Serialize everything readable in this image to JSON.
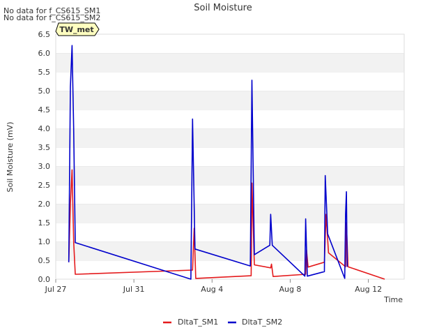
{
  "notes": [
    "No data for f_CS615_SM1",
    "No data for f_CS615_SM2"
  ],
  "badge": "TW_met",
  "chart_data": {
    "type": "line",
    "title": "Soil Moisture",
    "xlabel": "Time",
    "ylabel": "Soil Moisture (mV)",
    "ylim": [
      0.0,
      6.5
    ],
    "yticks": [
      "0.0",
      "0.5",
      "1.0",
      "1.5",
      "2.0",
      "2.5",
      "3.0",
      "3.5",
      "4.0",
      "4.5",
      "5.0",
      "5.5",
      "6.0",
      "6.5"
    ],
    "xlim": [
      "2024-07-27",
      "2024-08-13 20:00"
    ],
    "xticks": [
      {
        "label": "Jul 27",
        "date": "2024-07-27"
      },
      {
        "label": "Jul 31",
        "date": "2024-07-31"
      },
      {
        "label": "Aug 4",
        "date": "2024-08-04"
      },
      {
        "label": "Aug 8",
        "date": "2024-08-08"
      },
      {
        "label": "Aug 12",
        "date": "2024-08-12"
      }
    ],
    "grid": "horizontal bands",
    "legend": "bottom-center",
    "series": [
      {
        "name": "DltaT_SM1",
        "color": "#e41a1c",
        "points": [
          [
            "2024-07-27 16:00",
            0.45
          ],
          [
            "2024-07-27 18:00",
            2.0
          ],
          [
            "2024-07-27 20:00",
            2.9
          ],
          [
            "2024-07-27 22:00",
            1.0
          ],
          [
            "2024-07-28 00:00",
            0.13
          ],
          [
            "2024-08-03 00:00",
            0.24
          ],
          [
            "2024-08-03 02:00",
            1.35
          ],
          [
            "2024-08-03 04:00",
            0.02
          ],
          [
            "2024-08-06 00:00",
            0.09
          ],
          [
            "2024-08-06 01:00",
            2.55
          ],
          [
            "2024-08-06 04:00",
            0.38
          ],
          [
            "2024-08-07 00:00",
            0.3
          ],
          [
            "2024-08-07 01:00",
            0.4
          ],
          [
            "2024-08-07 03:00",
            0.07
          ],
          [
            "2024-08-08 19:00",
            0.13
          ],
          [
            "2024-08-08 20:00",
            0.78
          ],
          [
            "2024-08-08 22:00",
            0.32
          ],
          [
            "2024-08-09 18:00",
            0.45
          ],
          [
            "2024-08-09 20:00",
            1.72
          ],
          [
            "2024-08-09 23:00",
            0.7
          ],
          [
            "2024-08-10 20:00",
            0.33
          ],
          [
            "2024-08-10 21:00",
            1.5
          ],
          [
            "2024-08-10 23:00",
            0.33
          ],
          [
            "2024-08-12 20:00",
            0.0
          ]
        ]
      },
      {
        "name": "DltaT_SM2",
        "color": "#0000cc",
        "points": [
          [
            "2024-07-27 16:00",
            0.45
          ],
          [
            "2024-07-27 18:00",
            5.1
          ],
          [
            "2024-07-27 20:00",
            6.2
          ],
          [
            "2024-07-27 22:00",
            4.0
          ],
          [
            "2024-07-28 00:00",
            0.97
          ],
          [
            "2024-08-02 22:00",
            0.0
          ],
          [
            "2024-08-03 00:00",
            4.25
          ],
          [
            "2024-08-03 03:00",
            0.8
          ],
          [
            "2024-08-05 23:00",
            0.35
          ],
          [
            "2024-08-06 01:00",
            5.28
          ],
          [
            "2024-08-06 04:00",
            0.65
          ],
          [
            "2024-08-06 23:00",
            0.9
          ],
          [
            "2024-08-07 00:00",
            1.72
          ],
          [
            "2024-08-07 02:00",
            0.9
          ],
          [
            "2024-08-08 18:00",
            0.08
          ],
          [
            "2024-08-08 19:00",
            1.6
          ],
          [
            "2024-08-08 21:00",
            0.08
          ],
          [
            "2024-08-09 18:00",
            0.2
          ],
          [
            "2024-08-09 19:00",
            2.75
          ],
          [
            "2024-08-09 22:00",
            1.2
          ],
          [
            "2024-08-10 19:00",
            0.02
          ],
          [
            "2024-08-10 20:00",
            1.73
          ],
          [
            "2024-08-10 21:00",
            2.32
          ],
          [
            "2024-08-10 22:00",
            0.33
          ]
        ]
      }
    ]
  }
}
